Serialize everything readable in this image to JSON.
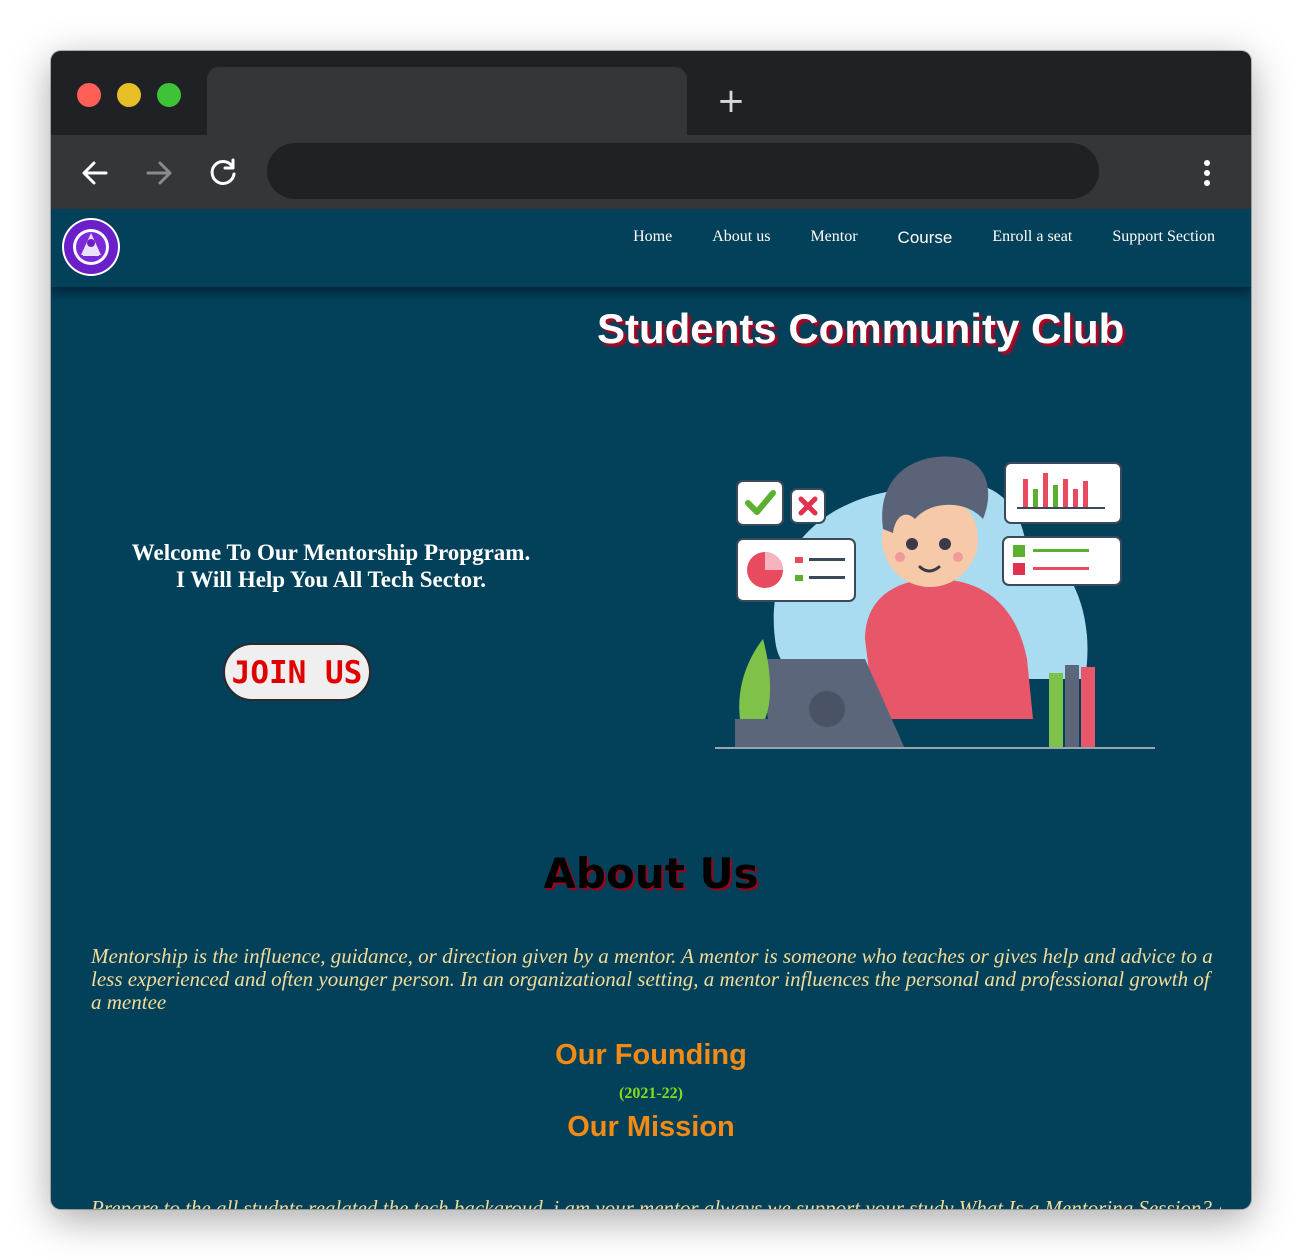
{
  "browser": {
    "new_tab_symbol": "+",
    "icons": [
      "back-arrow-icon",
      "forward-arrow-icon",
      "reload-icon",
      "more-vert-icon"
    ]
  },
  "site": {
    "logo_text": "STUDENTS COMMUNITY CLUB",
    "nav": [
      "Home",
      "About us",
      "Mentor",
      "Course",
      "Enroll a seat",
      "Support Section"
    ]
  },
  "hero": {
    "title": "Students Community Club",
    "welcome_line1": "Welcome To Our Mentorship Propgram.",
    "welcome_line2": "I Will Help You All Tech Sector.",
    "join_label": "JOIN US"
  },
  "about": {
    "title": "About Us",
    "text": "Mentorship is the influence, guidance, or direction given by a mentor. A mentor is someone who teaches or gives help and advice to a less experienced and often younger person. In an organizational setting, a mentor influences the personal and professional growth of a mentee",
    "founding_title": "Our Founding",
    "founding_year": "(2021-22)",
    "mission_title": "Our Mission",
    "mission_text": "Prepare to the all studnts realated the tech backgroud, i am your mentor always we support your study What Is a Mentoring Session? A"
  },
  "colors": {
    "page_bg": "#03415a",
    "title_shadow": "#b8001f",
    "accent_orange": "#f28a14",
    "year_green": "#86dc1a",
    "body_text": "#f1dc9a",
    "join_text": "#e00000"
  }
}
